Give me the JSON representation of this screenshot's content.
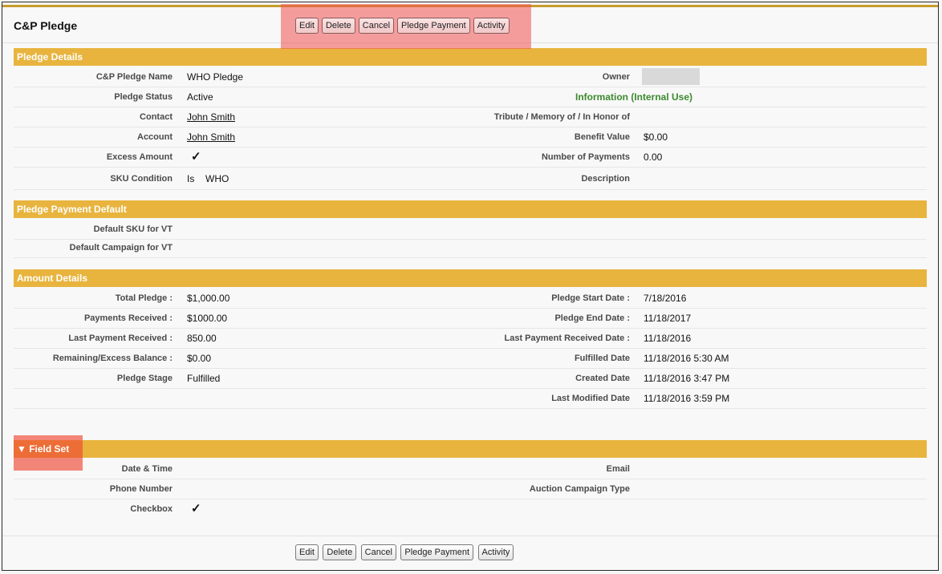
{
  "page": {
    "title": "C&P Pledge",
    "corner_text": "~ ~ ~ ~ ~ ~"
  },
  "toolbar": {
    "edit_label": "Edit",
    "delete_label": "Delete",
    "cancel_label": "Cancel",
    "pledge_payment_label": "Pledge Payment",
    "activity_label": "Activity"
  },
  "pledge_details": {
    "title": "Pledge Details",
    "name_label": "C&P Pledge Name",
    "name_value": "WHO Pledge",
    "owner_label": "Owner",
    "status_label": "Pledge Status",
    "status_value": "Active",
    "info_heading": "Information (Internal Use)",
    "contact_label": "Contact",
    "contact_value": "John Smith",
    "tribute_label": "Tribute / Memory of / In Honor of",
    "account_label": "Account",
    "account_value": "John Smith",
    "benefit_label": "Benefit Value",
    "benefit_value": "$0.00",
    "excess_label": "Excess Amount",
    "excess_check": "✓",
    "num_payments_label": "Number of Payments",
    "num_payments_value": "0.00",
    "sku_label": "SKU Condition",
    "sku_op": "Is",
    "sku_value": "WHO",
    "description_label": "Description"
  },
  "payment_default": {
    "title": "Pledge Payment Default",
    "sku_label": "Default SKU for VT",
    "campaign_label": "Default Campaign for VT"
  },
  "amount_details": {
    "title": "Amount Details",
    "total_label": "Total Pledge :",
    "total_value": "$1,000.00",
    "start_label": "Pledge Start Date :",
    "start_value": "7/18/2016",
    "received_label": "Payments Received :",
    "received_value": "$1000.00",
    "end_label": "Pledge End Date :",
    "end_value": "11/18/2017",
    "last_payment_label": "Last Payment Received :",
    "last_payment_value": "850.00",
    "last_payment_date_label": "Last Payment Received Date :",
    "last_payment_date_value": "11/18/2016",
    "remaining_label": "Remaining/Excess Balance :",
    "remaining_value": "$0.00",
    "fulfilled_label": "Fulfilled Date",
    "fulfilled_value": "11/18/2016 5:30 AM",
    "stage_label": "Pledge Stage",
    "stage_value": "Fulfilled",
    "created_label": "Created Date",
    "created_value": "11/18/2016 3:47 PM",
    "modified_label": "Last Modified Date",
    "modified_value": "11/18/2016 3:59 PM"
  },
  "field_set": {
    "title": "▼ Field Set",
    "datetime_label": "Date & Time",
    "email_label": "Email",
    "phone_label": "Phone Number",
    "auction_label": "Auction Campaign Type",
    "checkbox_label": "Checkbox",
    "checkbox_check": "✓"
  },
  "colors": {
    "section_bar": "#e8b43e",
    "info_green": "#3b8a2e",
    "highlight": "#f05050"
  }
}
